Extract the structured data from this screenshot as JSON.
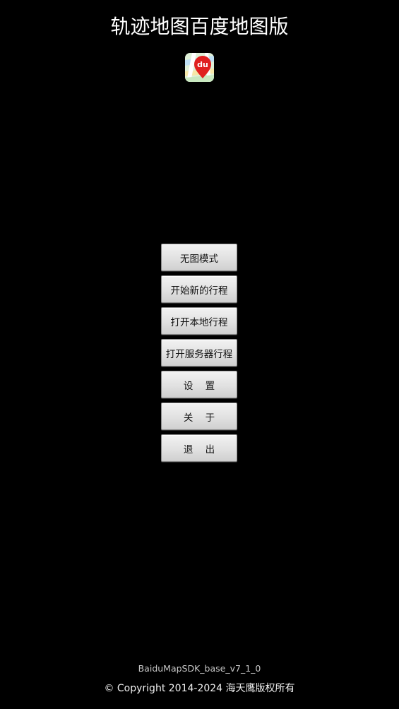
{
  "app": {
    "title": "轨迹地图百度地图版",
    "logo_icon": "baidu-map-logo-icon",
    "logo_text": "du",
    "accent_color": "#e02020"
  },
  "menu": {
    "buttons": [
      {
        "label": "无图模式"
      },
      {
        "label": "开始新的行程"
      },
      {
        "label": "打开本地行程"
      },
      {
        "label": "打开服务器行程"
      },
      {
        "label": "设    置"
      },
      {
        "label": "关    于"
      },
      {
        "label": "退    出"
      }
    ]
  },
  "footer": {
    "sdk_version": "BaiduMapSDK_base_v7_1_0",
    "copyright": "© Copyright 2014-2024 海天鹰版权所有"
  }
}
